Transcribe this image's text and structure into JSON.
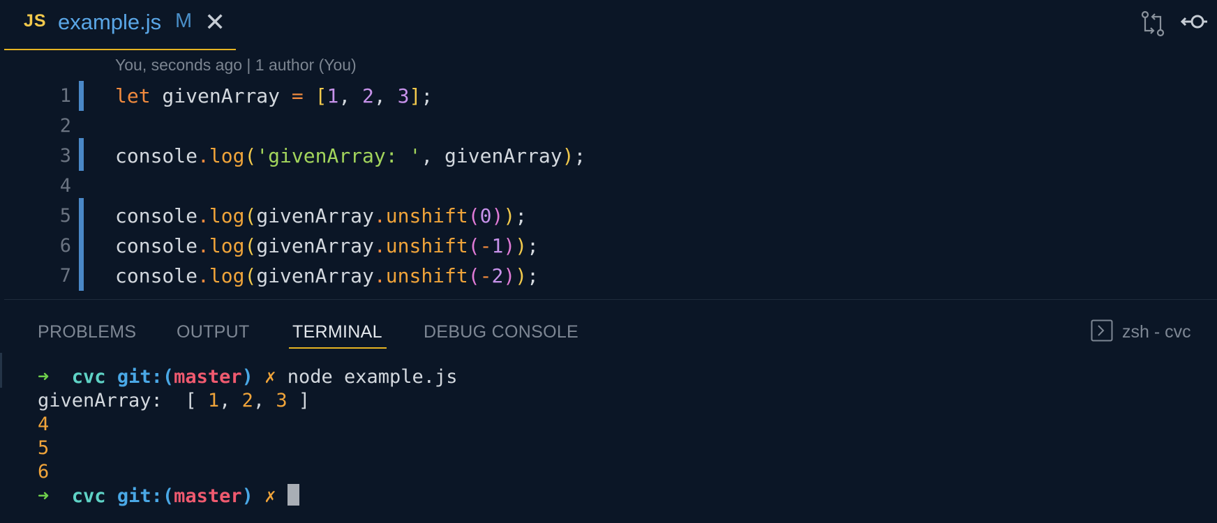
{
  "tab": {
    "icon_label": "JS",
    "file_name": "example.js",
    "modified_indicator": "M",
    "close_label": "✕"
  },
  "titlebar_icons": [
    "source-control-compare-icon",
    "timeline-icon"
  ],
  "editor": {
    "blame": "You, seconds ago | 1 author (You)",
    "lines": [
      {
        "num": "1",
        "modified": true,
        "tokens": [
          {
            "t": "let",
            "c": "kw"
          },
          {
            "t": " givenArray ",
            "c": "pun"
          },
          {
            "t": "=",
            "c": "op"
          },
          {
            "t": " ",
            "c": "pun"
          },
          {
            "t": "[",
            "c": "br"
          },
          {
            "t": "1",
            "c": "num"
          },
          {
            "t": ", ",
            "c": "pun"
          },
          {
            "t": "2",
            "c": "num"
          },
          {
            "t": ", ",
            "c": "pun"
          },
          {
            "t": "3",
            "c": "num"
          },
          {
            "t": "]",
            "c": "br"
          },
          {
            "t": ";",
            "c": "pun"
          }
        ]
      },
      {
        "num": "2",
        "modified": false,
        "tokens": []
      },
      {
        "num": "3",
        "modified": true,
        "tokens": [
          {
            "t": "console",
            "c": "pun"
          },
          {
            "t": ".",
            "c": "op"
          },
          {
            "t": "log",
            "c": "fn"
          },
          {
            "t": "(",
            "c": "br"
          },
          {
            "t": "'givenArray: '",
            "c": "str"
          },
          {
            "t": ", givenArray",
            "c": "pun"
          },
          {
            "t": ")",
            "c": "br"
          },
          {
            "t": ";",
            "c": "pun"
          }
        ]
      },
      {
        "num": "4",
        "modified": false,
        "tokens": []
      },
      {
        "num": "5",
        "modified": true,
        "tokens": [
          {
            "t": "console",
            "c": "pun"
          },
          {
            "t": ".",
            "c": "op"
          },
          {
            "t": "log",
            "c": "fn"
          },
          {
            "t": "(",
            "c": "br"
          },
          {
            "t": "givenArray",
            "c": "pun"
          },
          {
            "t": ".",
            "c": "op"
          },
          {
            "t": "unshift",
            "c": "fn"
          },
          {
            "t": "(",
            "c": "br2"
          },
          {
            "t": "0",
            "c": "num"
          },
          {
            "t": ")",
            "c": "br2"
          },
          {
            "t": ")",
            "c": "br"
          },
          {
            "t": ";",
            "c": "pun"
          }
        ]
      },
      {
        "num": "6",
        "modified": true,
        "tokens": [
          {
            "t": "console",
            "c": "pun"
          },
          {
            "t": ".",
            "c": "op"
          },
          {
            "t": "log",
            "c": "fn"
          },
          {
            "t": "(",
            "c": "br"
          },
          {
            "t": "givenArray",
            "c": "pun"
          },
          {
            "t": ".",
            "c": "op"
          },
          {
            "t": "unshift",
            "c": "fn"
          },
          {
            "t": "(",
            "c": "br2"
          },
          {
            "t": "-",
            "c": "op"
          },
          {
            "t": "1",
            "c": "num"
          },
          {
            "t": ")",
            "c": "br2"
          },
          {
            "t": ")",
            "c": "br"
          },
          {
            "t": ";",
            "c": "pun"
          }
        ]
      },
      {
        "num": "7",
        "modified": true,
        "tokens": [
          {
            "t": "console",
            "c": "pun"
          },
          {
            "t": ".",
            "c": "op"
          },
          {
            "t": "log",
            "c": "fn"
          },
          {
            "t": "(",
            "c": "br"
          },
          {
            "t": "givenArray",
            "c": "pun"
          },
          {
            "t": ".",
            "c": "op"
          },
          {
            "t": "unshift",
            "c": "fn"
          },
          {
            "t": "(",
            "c": "br2"
          },
          {
            "t": "-",
            "c": "op"
          },
          {
            "t": "2",
            "c": "num"
          },
          {
            "t": ")",
            "c": "br2"
          },
          {
            "t": ")",
            "c": "br"
          },
          {
            "t": ";",
            "c": "pun"
          }
        ]
      }
    ]
  },
  "panel": {
    "tabs": [
      {
        "label": "PROBLEMS",
        "active": false
      },
      {
        "label": "OUTPUT",
        "active": false
      },
      {
        "label": "TERMINAL",
        "active": true
      },
      {
        "label": "DEBUG CONSOLE",
        "active": false
      }
    ],
    "terminal_name": "zsh - cvc"
  },
  "terminal": {
    "prompt": {
      "arrow": "➜",
      "dir": "cvc",
      "git_prefix": "git:(",
      "branch": "master",
      "git_suffix": ")",
      "dirty": "✗"
    },
    "command": "node example.js",
    "output": {
      "label": "givenArray:  [ ",
      "values": [
        "1",
        "2",
        "3"
      ],
      "closing": " ]",
      "results": [
        "4",
        "5",
        "6"
      ]
    }
  },
  "colors": {
    "background": "#0b1626",
    "accent": "#e6b422",
    "gutter_modified": "#4a88c7"
  }
}
